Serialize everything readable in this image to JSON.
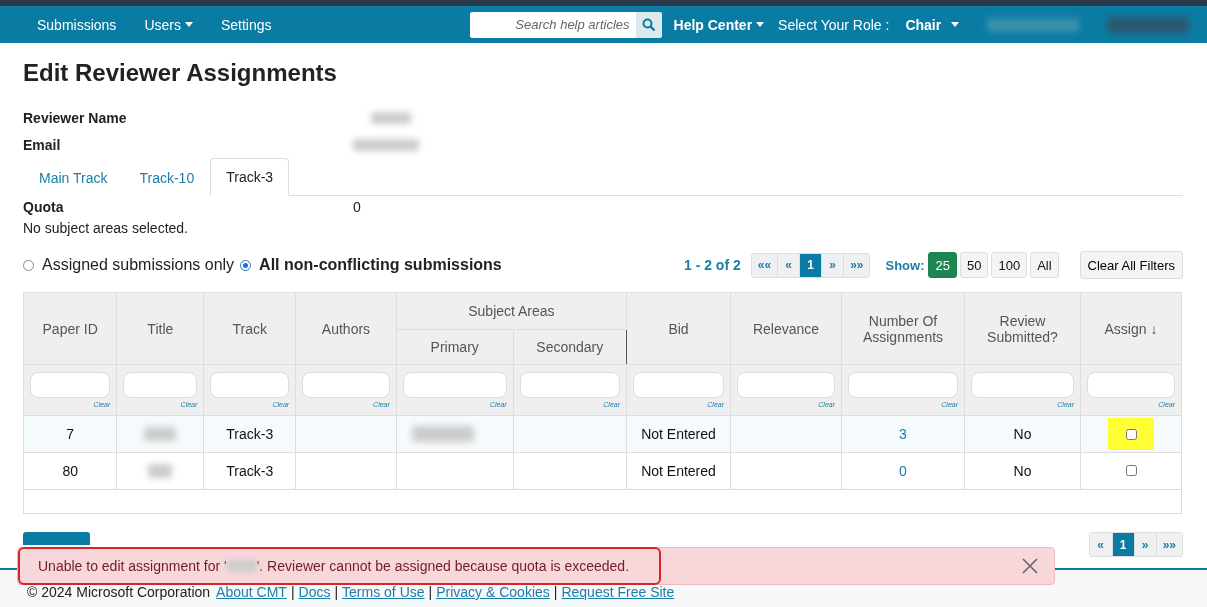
{
  "navbar": {
    "items": [
      {
        "label": "Submissions",
        "dropdown": false
      },
      {
        "label": "Users",
        "dropdown": true
      },
      {
        "label": "Settings",
        "dropdown": false
      }
    ],
    "search": {
      "placeholder": "Search help articles"
    },
    "help_center": "Help Center",
    "role_label": "Select Your Role :",
    "role": "Chair"
  },
  "title": "Edit Reviewer Assignments",
  "details": [
    {
      "label": "Reviewer Name",
      "redacted": true
    },
    {
      "label": "Email",
      "redacted": true
    }
  ],
  "tabs": [
    {
      "label": "Main Track",
      "selected": false
    },
    {
      "label": "Track-10",
      "selected": false
    },
    {
      "label": "Track-3",
      "selected": true
    }
  ],
  "quota": {
    "label": "Quota",
    "value": "0"
  },
  "subject_note": "No subject areas selected.",
  "filter_options": [
    {
      "label": "Assigned submissions only",
      "selected": false
    },
    {
      "label": "All non-conflicting submissions",
      "selected": true
    }
  ],
  "pagination": {
    "summary": "1 - 2 of 2",
    "pages": [
      {
        "label": "««",
        "selected": false
      },
      {
        "label": "«",
        "selected": false
      },
      {
        "label": "1",
        "selected": true
      },
      {
        "label": "»",
        "selected": false
      },
      {
        "label": "»»",
        "selected": false
      }
    ]
  },
  "show": {
    "label": "Show:",
    "options": [
      {
        "label": "25",
        "selected": true
      },
      {
        "label": "50",
        "selected": false
      },
      {
        "label": "100",
        "selected": false
      },
      {
        "label": "All",
        "selected": false
      }
    ]
  },
  "clear_all": "Clear All Filters",
  "table": {
    "group_header": "Subject Areas",
    "columns": [
      {
        "label": "Paper ID",
        "clear": "Clear"
      },
      {
        "label": "Title",
        "clear": "Clear"
      },
      {
        "label": "Track",
        "clear": "Clear"
      },
      {
        "label": "Authors",
        "clear": "Clear"
      },
      {
        "label": "Primary",
        "clear": "Clear"
      },
      {
        "label": "Secondary",
        "clear": "Clear"
      },
      {
        "label": "Bid",
        "clear": "Clear"
      },
      {
        "label": "Relevance",
        "clear": "Clear"
      },
      {
        "label": "Number Of Assignments",
        "clear": "Clear"
      },
      {
        "label": "Review Submitted?",
        "clear": "Clear"
      },
      {
        "label": "Assign ↓",
        "clear": "Clear"
      }
    ],
    "rows": [
      {
        "paper_id": "7",
        "title_redacted": true,
        "track": "Track-3",
        "primary_redacted": true,
        "bid": "Not Entered",
        "assignments": "3",
        "review_submitted": "No",
        "checked": false,
        "highlighted": true
      },
      {
        "paper_id": "80",
        "title_redacted": true,
        "track": "Track-3",
        "primary_redacted": false,
        "bid": "Not Entered",
        "assignments": "0",
        "review_submitted": "No",
        "checked": false,
        "highlighted": false
      }
    ]
  },
  "bottom_pagination": {
    "pages": [
      {
        "label": "«",
        "selected": false
      },
      {
        "label": "1",
        "selected": true
      },
      {
        "label": "»",
        "selected": false
      },
      {
        "label": "»»",
        "selected": false
      }
    ]
  },
  "alert": {
    "prefix": "Unable to edit assignment for '",
    "suffix": "'. Reviewer cannot be assigned because quota is exceeded."
  },
  "footer": [
    {
      "kind": "text",
      "text": "© 2024 Microsoft Corporation"
    },
    {
      "kind": "link",
      "text": "About CMT"
    },
    {
      "kind": "separator",
      "text": "|"
    },
    {
      "kind": "link",
      "text": "Docs"
    },
    {
      "kind": "separator",
      "text": "|"
    },
    {
      "kind": "link",
      "text": "Terms of Use"
    },
    {
      "kind": "separator",
      "text": "|"
    },
    {
      "kind": "link",
      "text": "Privacy & Cookies"
    },
    {
      "kind": "separator",
      "text": "|"
    },
    {
      "kind": "link",
      "text": "Request Free Site"
    }
  ]
}
